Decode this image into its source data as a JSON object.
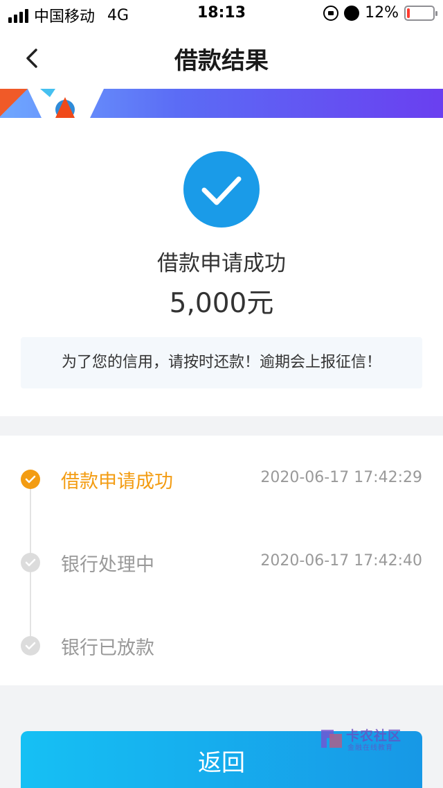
{
  "status_bar": {
    "carrier": "中国移动",
    "network": "4G",
    "time": "18:13",
    "battery_text": "12%",
    "battery_level": 0.12,
    "icons": [
      "signal-icon",
      "orientation-lock-icon",
      "alarm-icon",
      "battery-icon"
    ]
  },
  "nav": {
    "title": "借款结果",
    "back_icon": "chevron-left-icon"
  },
  "result": {
    "title": "借款申请成功",
    "amount": "5,000元",
    "notice": "为了您的信用，请按时还款！逾期会上报征信！",
    "icon": "check-circle-icon"
  },
  "timeline": {
    "steps": [
      {
        "label": "借款申请成功",
        "time": "2020-06-17 17:42:29",
        "state": "done"
      },
      {
        "label": "银行处理中",
        "time": "2020-06-17 17:42:40",
        "state": "pending"
      },
      {
        "label": "银行已放款",
        "time": "",
        "state": "pending"
      }
    ]
  },
  "actions": {
    "return_label": "返回"
  },
  "watermark": {
    "title": "卡农社区",
    "subtitle": "金融在线教育"
  },
  "colors": {
    "accent_blue": "#1a9be8",
    "active_orange": "#f39c12",
    "muted_gray": "#999999",
    "battery_red": "#ff3b30"
  }
}
